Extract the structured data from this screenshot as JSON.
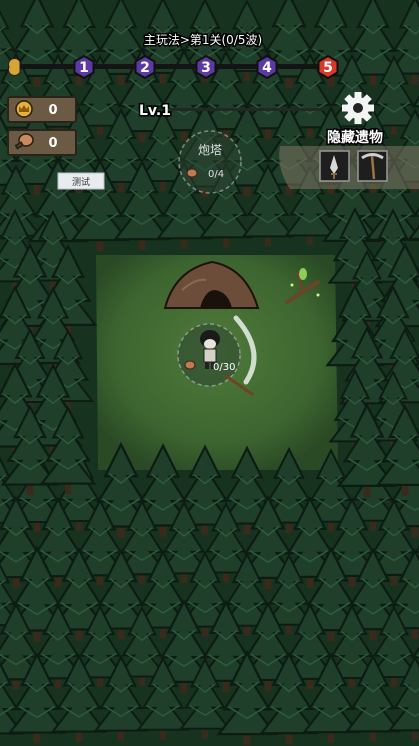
{
  "header": {
    "breadcrumb": "主玩法>第1关(0/5波)",
    "waves": [
      "1",
      "2",
      "3",
      "4",
      "5"
    ],
    "wave_colors": [
      "#5b3aa5",
      "#5b3aa5",
      "#5b3aa5",
      "#5b3aa5",
      "#d9382b"
    ]
  },
  "resources": [
    {
      "icon": "gold-crown-coin-icon",
      "value": "0"
    },
    {
      "icon": "meat-drumstick-icon",
      "value": "0"
    }
  ],
  "test_button": "测试",
  "player_level": {
    "label": "Lv.1",
    "progress": 0
  },
  "settings": {
    "icon": "gear-icon"
  },
  "relics": {
    "title": "隐藏遗物",
    "items": [
      {
        "icon": "dagger-icon"
      },
      {
        "icon": "pickaxe-icon"
      }
    ]
  },
  "build_slot": {
    "name": "炮塔",
    "cost": "0/4"
  },
  "player": {
    "carry_text": "0/30"
  }
}
